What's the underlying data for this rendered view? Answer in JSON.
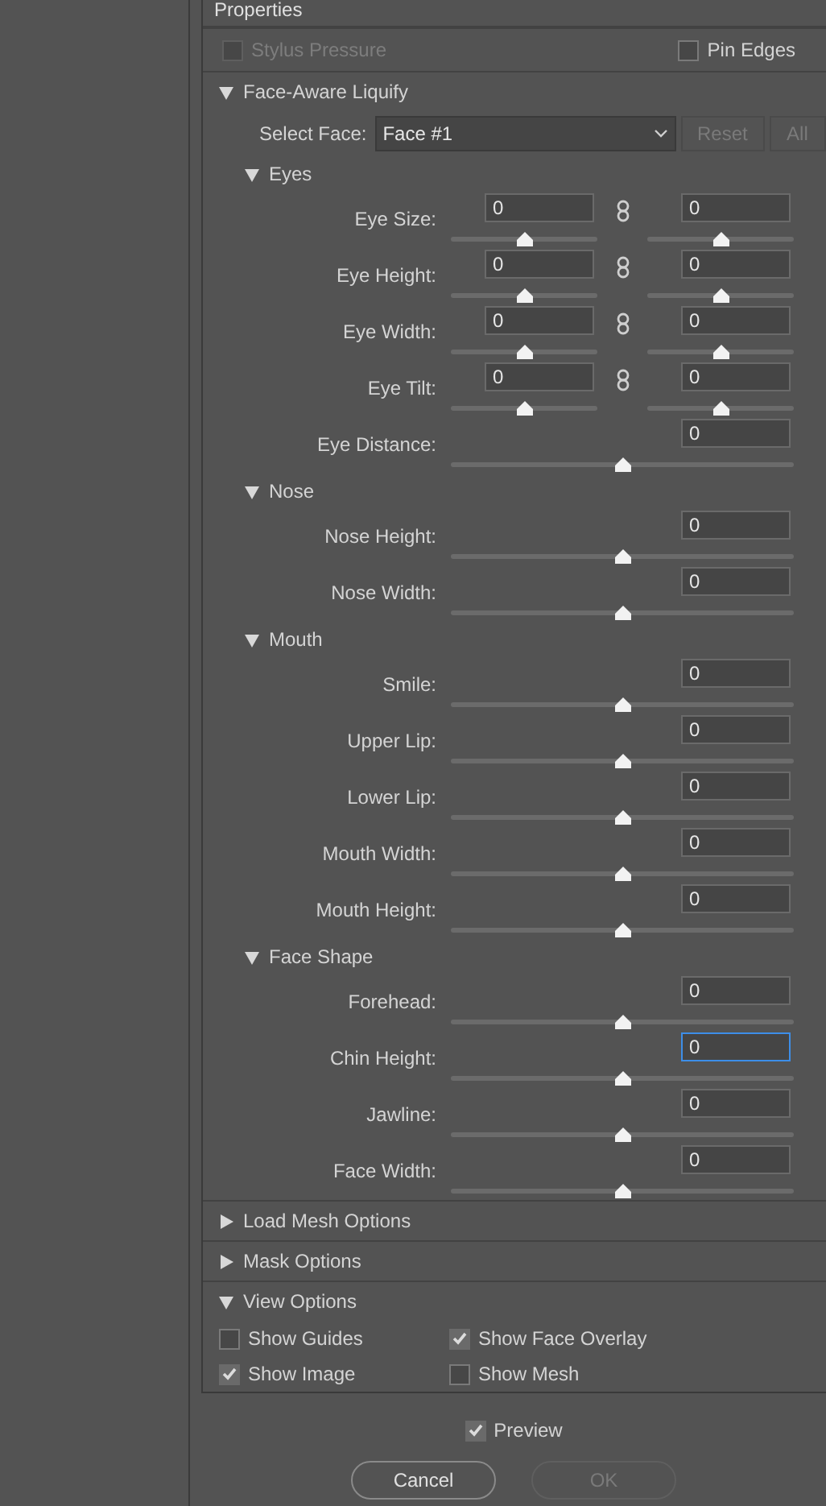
{
  "panel_title": "Properties",
  "top_options": [
    {
      "label": "Stylus Pressure",
      "checked": false,
      "disabled": true
    },
    {
      "label": "Pin Edges",
      "checked": false,
      "disabled": false
    }
  ],
  "face_aware": {
    "title": "Face-Aware Liquify",
    "expanded": true,
    "select_face": {
      "label": "Select Face:",
      "value": "Face #1"
    },
    "buttons": [
      {
        "label": "Reset",
        "disabled": true
      },
      {
        "label": "All",
        "disabled": true
      }
    ],
    "groups": [
      {
        "title": "Eyes",
        "expanded": true,
        "rows": [
          {
            "kind": "pair",
            "label": "Eye Size:",
            "left": {
              "value": "0",
              "level": 0.5
            },
            "right": {
              "value": "0",
              "level": 0.5
            }
          },
          {
            "kind": "pair",
            "label": "Eye Height:",
            "left": {
              "value": "0",
              "level": 0.5
            },
            "right": {
              "value": "0",
              "level": 0.5
            }
          },
          {
            "kind": "pair",
            "label": "Eye Width:",
            "left": {
              "value": "0",
              "level": 0.5
            },
            "right": {
              "value": "0",
              "level": 0.5
            }
          },
          {
            "kind": "pair",
            "label": "Eye Tilt:",
            "left": {
              "value": "0",
              "level": 0.5
            },
            "right": {
              "value": "0",
              "level": 0.5
            }
          },
          {
            "kind": "single",
            "label": "Eye Distance:",
            "value": "0",
            "level": 0.5,
            "focused": false
          }
        ]
      },
      {
        "title": "Nose",
        "expanded": true,
        "rows": [
          {
            "kind": "single",
            "label": "Nose Height:",
            "value": "0",
            "level": 0.5,
            "focused": false
          },
          {
            "kind": "single",
            "label": "Nose Width:",
            "value": "0",
            "level": 0.5,
            "focused": false
          }
        ]
      },
      {
        "title": "Mouth",
        "expanded": true,
        "rows": [
          {
            "kind": "single",
            "label": "Smile:",
            "value": "0",
            "level": 0.5,
            "focused": false
          },
          {
            "kind": "single",
            "label": "Upper Lip:",
            "value": "0",
            "level": 0.5,
            "focused": false
          },
          {
            "kind": "single",
            "label": "Lower Lip:",
            "value": "0",
            "level": 0.5,
            "focused": false
          },
          {
            "kind": "single",
            "label": "Mouth Width:",
            "value": "0",
            "level": 0.5,
            "focused": false
          },
          {
            "kind": "single",
            "label": "Mouth Height:",
            "value": "0",
            "level": 0.5,
            "focused": false
          }
        ]
      },
      {
        "title": "Face Shape",
        "expanded": true,
        "rows": [
          {
            "kind": "single",
            "label": "Forehead:",
            "value": "0",
            "level": 0.5,
            "focused": false
          },
          {
            "kind": "single",
            "label": "Chin Height:",
            "value": "0",
            "level": 0.5,
            "focused": true
          },
          {
            "kind": "single",
            "label": "Jawline:",
            "value": "0",
            "level": 0.5,
            "focused": false
          },
          {
            "kind": "single",
            "label": "Face Width:",
            "value": "0",
            "level": 0.5,
            "focused": false
          }
        ]
      }
    ]
  },
  "sections": [
    {
      "title": "Load Mesh Options",
      "expanded": false
    },
    {
      "title": "Mask Options",
      "expanded": false
    },
    {
      "title": "View Options",
      "expanded": true,
      "options": [
        {
          "label": "Show Guides",
          "checked": false
        },
        {
          "label": "Show Face Overlay",
          "checked": true
        },
        {
          "label": "Show Image",
          "checked": true
        },
        {
          "label": "Show Mesh",
          "checked": false
        }
      ]
    }
  ],
  "preview": {
    "label": "Preview",
    "checked": true
  },
  "dialog_buttons": [
    {
      "label": "Cancel",
      "disabled": false
    },
    {
      "label": "OK",
      "disabled": true
    }
  ]
}
